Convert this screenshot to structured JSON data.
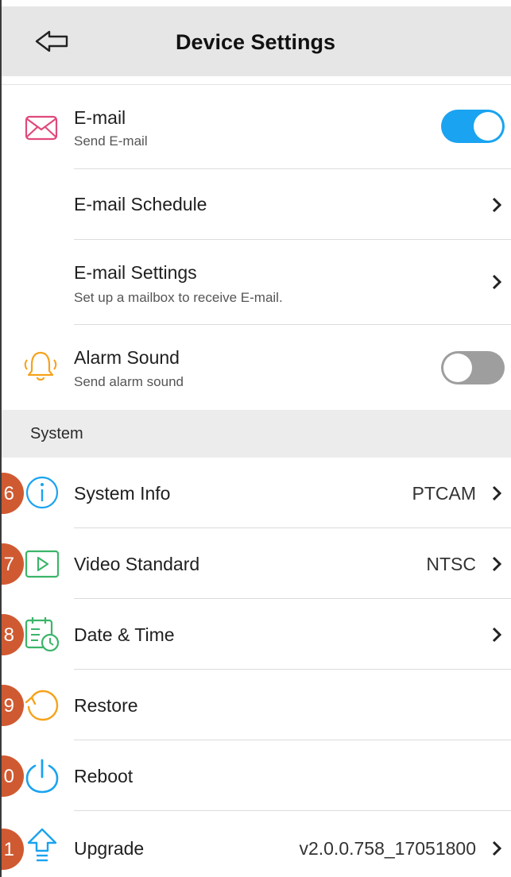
{
  "header": {
    "title": "Device Settings"
  },
  "email": {
    "label": "E-mail",
    "sub": "Send E-mail",
    "enabled": true
  },
  "email_schedule": {
    "label": "E-mail Schedule"
  },
  "email_settings": {
    "label": "E-mail Settings",
    "sub": "Set up a mailbox to receive E-mail."
  },
  "alarm": {
    "label": "Alarm Sound",
    "sub": "Send alarm sound",
    "enabled": false
  },
  "section": {
    "label": "System"
  },
  "system_info": {
    "label": "System Info",
    "value": "PTCAM",
    "badge": "6"
  },
  "video_standard": {
    "label": "Video Standard",
    "value": "NTSC",
    "badge": "7"
  },
  "date_time": {
    "label": "Date & Time",
    "badge": "8"
  },
  "restore": {
    "label": "Restore",
    "badge": "9"
  },
  "reboot": {
    "label": "Reboot",
    "badge": "0"
  },
  "upgrade": {
    "label": "Upgrade",
    "value": "v2.0.0.758_17051800",
    "badge": "1"
  },
  "colors": {
    "toggle_on": "#1aa3f0",
    "toggle_off": "#9e9e9e",
    "badge": "#cf5a32",
    "email_icon": "#e04a7a",
    "alarm_icon": "#f5a21b",
    "info_icon": "#1aa3f0",
    "video_icon": "#3bb56a",
    "date_icon": "#3bb56a",
    "restore_icon": "#f5a21b",
    "reboot_icon": "#1aa3f0",
    "upgrade_icon": "#1aa3f0"
  }
}
